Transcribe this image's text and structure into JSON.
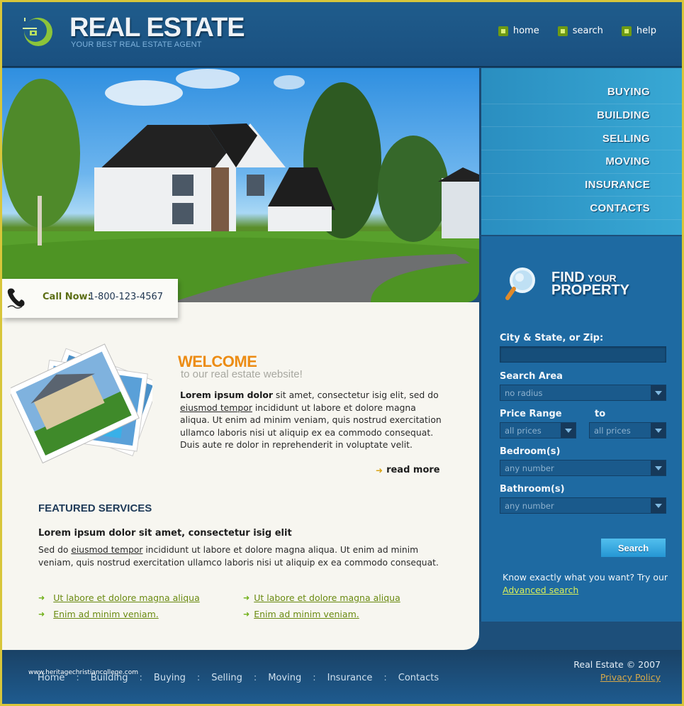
{
  "header": {
    "logo_title": "REAL ESTATE",
    "logo_tagline": "YOUR BEST REAL ESTATE AGENT",
    "top_nav": [
      {
        "label": "home",
        "icon": "green-square-bullet-icon"
      },
      {
        "label": "search",
        "icon": "green-square-bullet-icon"
      },
      {
        "label": "help",
        "icon": "green-square-bullet-icon"
      }
    ]
  },
  "hero": {
    "image": "house-photo",
    "call_label": "Call Now:",
    "call_number": "1-800-123-4567",
    "phone_icon": "phone-icon"
  },
  "side_menu": {
    "items": [
      "BUYING",
      "BUILDING",
      "SELLING",
      "MOVING",
      "INSURANCE",
      "CONTACTS"
    ]
  },
  "welcome": {
    "title": "WELCOME",
    "subtitle": "to our real estate website!",
    "text_bold": "Lorem ipsum dolor",
    "text_1": " sit amet, consectetur isig elit, sed do ",
    "text_link": "eiusmod tempor",
    "text_2": " incididunt ut labore et dolore magna aliqua. Ut enim ad minim veniam, quis nostrud exercitation ullamco laboris nisi ut aliquip ex ea commodo consequat. Duis aute re dolor in reprehenderit in voluptate velit.",
    "read_more": "read more"
  },
  "featured": {
    "title": "FEATURED SERVICES",
    "heading": "Lorem ipsum dolor sit amet, consectetur isig elit",
    "text_1": "Sed do ",
    "text_link": "eiusmod tempor",
    "text_2": " incididunt ut labore et dolore magna aliqua. Ut enim ad minim veniam, quis nostrud exercitation ullamco laboris nisi ut aliquip ex ea commodo consequat.",
    "links_left": [
      "Ut labore et dolore magna aliqua",
      "Enim ad minim veniam."
    ],
    "links_right": [
      "Ut labore et dolore magna aliqua",
      "Enim ad minim veniam."
    ]
  },
  "search_panel": {
    "title_find": "FIND",
    "title_your": "YOUR",
    "title_property": "PROPERTY",
    "city_label": "City & State, or Zip:",
    "city_value": "",
    "area_label": "Search Area",
    "area_value": "no radius",
    "price_label": "Price Range",
    "price_to_label": "to",
    "price_from_value": "all prices",
    "price_to_value": "all prices",
    "bedroom_label": "Bedroom(s)",
    "bedroom_value": "any number",
    "bathroom_label": "Bathroom(s)",
    "bathroom_value": "any number",
    "search_button": "Search",
    "know_text": "Know exactly what you want? Try our",
    "advanced_link": "Advanced search"
  },
  "footer": {
    "nav": [
      "Home",
      "Building",
      "Buying",
      "Selling",
      "Moving",
      "Insurance",
      "Contacts"
    ],
    "separator": ":",
    "watermark": "www.heritagechristiancollege.com",
    "copyright": "Real Estate ©  2007",
    "privacy": "Privacy Policy"
  },
  "colors": {
    "header_bg": "#1f5c8c",
    "accent_orange": "#ec8c14",
    "link_green": "#6a8a10",
    "menu_blue": "#38a8d4",
    "panel_blue": "#1e6aa2",
    "page_border": "#d8c63a"
  }
}
